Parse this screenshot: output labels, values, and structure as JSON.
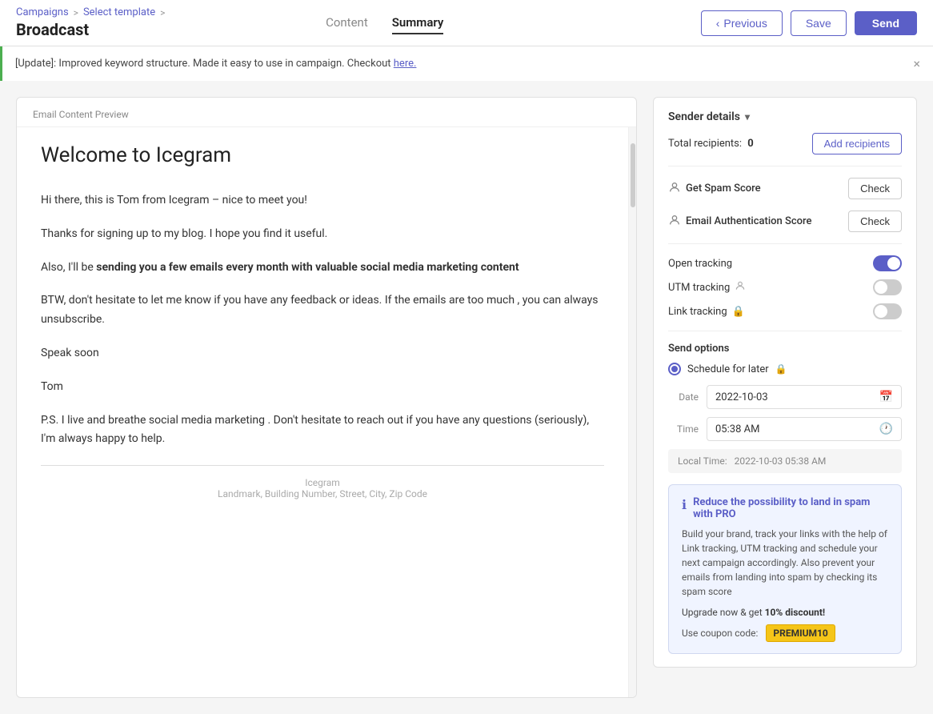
{
  "breadcrumb": {
    "campaigns": "Campaigns",
    "sep1": ">",
    "select_template": "Select template",
    "sep2": ">"
  },
  "page": {
    "title": "Broadcast"
  },
  "header_nav": {
    "tabs": [
      {
        "id": "content",
        "label": "Content",
        "active": false
      },
      {
        "id": "summary",
        "label": "Summary",
        "active": true
      }
    ]
  },
  "header_actions": {
    "previous": "Previous",
    "save": "Save",
    "send": "Send"
  },
  "banner": {
    "text": "[Update]: Improved keyword structure. Made it easy to use in campaign. Checkout ",
    "link_text": "here.",
    "close_icon": "×"
  },
  "preview": {
    "label": "Email Content Preview",
    "email_title": "Welcome to Icegram",
    "body": [
      "Hi there, this is Tom from Icegram – nice to meet you!",
      "Thanks for signing up to my blog. I hope you find it useful.",
      "Also, I'll be sending you a few emails every month with valuable social media marketing content",
      "BTW, don't hesitate to let me know if you have any feedback or ideas. If the emails are too much , you can always unsubscribe.",
      "Speak soon",
      "Tom",
      "P.S. I live and breathe social media marketing . Don't hesitate to reach out if you have any questions (seriously), I'm always happy to help."
    ],
    "bold_text": "sending you a few emails every month with valuable social media marketing content",
    "footer_company": "Icegram",
    "footer_address": "Landmark, Building Number, Street, City, Zip Code"
  },
  "sender_details": {
    "label": "Sender details",
    "chevron": "▾",
    "total_recipients_label": "Total recipients:",
    "total_recipients_count": "0",
    "add_recipients_btn": "Add recipients"
  },
  "spam_score": {
    "label": "Get Spam Score",
    "icon": "👤",
    "check_btn": "Check"
  },
  "auth_score": {
    "label": "Email Authentication Score",
    "icon": "👤",
    "check_btn": "Check"
  },
  "tracking": {
    "open_label": "Open tracking",
    "open_icon": "",
    "open_state": "on",
    "utm_label": "UTM tracking",
    "utm_icon": "👤",
    "utm_state": "off",
    "link_label": "Link tracking",
    "link_icon": "🔒",
    "link_state": "off"
  },
  "send_options": {
    "label": "Send options",
    "schedule_label": "Schedule for later",
    "lock_icon": "🔒",
    "date_label": "Date",
    "date_value": "2022-10-03",
    "time_label": "Time",
    "time_value": "05:38 AM",
    "local_time_label": "Local Time:",
    "local_time_value": "2022-10-03 05:38 AM"
  },
  "pro_banner": {
    "icon": "ℹ",
    "title": "Reduce the possibility to land in spam with PRO",
    "description": "Build your brand, track your links with the help of Link tracking, UTM tracking and schedule your next campaign accordingly. Also prevent your emails from landing into spam by checking its spam score",
    "upgrade_text": "Upgrade now & get ",
    "discount": "10% discount!",
    "coupon_label": "Use coupon code:",
    "coupon_code": "PREMIUM10"
  }
}
